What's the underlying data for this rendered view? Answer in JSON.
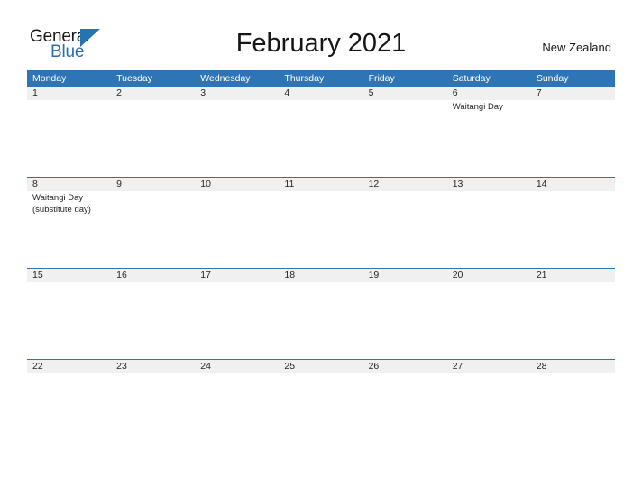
{
  "brand": {
    "name_part1": "General",
    "name_part2": "Blue",
    "triangle_color": "#2374b5",
    "blue_text_color": "#2b6cb2"
  },
  "header": {
    "title": "February 2021",
    "region": "New Zealand"
  },
  "theme": {
    "header_bar_color": "#2e75b6",
    "row_band_color": "#f0f0f0",
    "grid_line_color": "#2e75b6",
    "text_color": "#262626"
  },
  "calendar": {
    "weekdays": [
      "Monday",
      "Tuesday",
      "Wednesday",
      "Thursday",
      "Friday",
      "Saturday",
      "Sunday"
    ],
    "weeks": [
      [
        {
          "day": "1",
          "events": ""
        },
        {
          "day": "2",
          "events": ""
        },
        {
          "day": "3",
          "events": ""
        },
        {
          "day": "4",
          "events": ""
        },
        {
          "day": "5",
          "events": ""
        },
        {
          "day": "6",
          "events": "Waitangi Day"
        },
        {
          "day": "7",
          "events": ""
        }
      ],
      [
        {
          "day": "8",
          "events": "Waitangi Day\n(substitute day)"
        },
        {
          "day": "9",
          "events": ""
        },
        {
          "day": "10",
          "events": ""
        },
        {
          "day": "11",
          "events": ""
        },
        {
          "day": "12",
          "events": ""
        },
        {
          "day": "13",
          "events": ""
        },
        {
          "day": "14",
          "events": ""
        }
      ],
      [
        {
          "day": "15",
          "events": ""
        },
        {
          "day": "16",
          "events": ""
        },
        {
          "day": "17",
          "events": ""
        },
        {
          "day": "18",
          "events": ""
        },
        {
          "day": "19",
          "events": ""
        },
        {
          "day": "20",
          "events": ""
        },
        {
          "day": "21",
          "events": ""
        }
      ],
      [
        {
          "day": "22",
          "events": ""
        },
        {
          "day": "23",
          "events": ""
        },
        {
          "day": "24",
          "events": ""
        },
        {
          "day": "25",
          "events": ""
        },
        {
          "day": "26",
          "events": ""
        },
        {
          "day": "27",
          "events": ""
        },
        {
          "day": "28",
          "events": ""
        }
      ]
    ]
  }
}
